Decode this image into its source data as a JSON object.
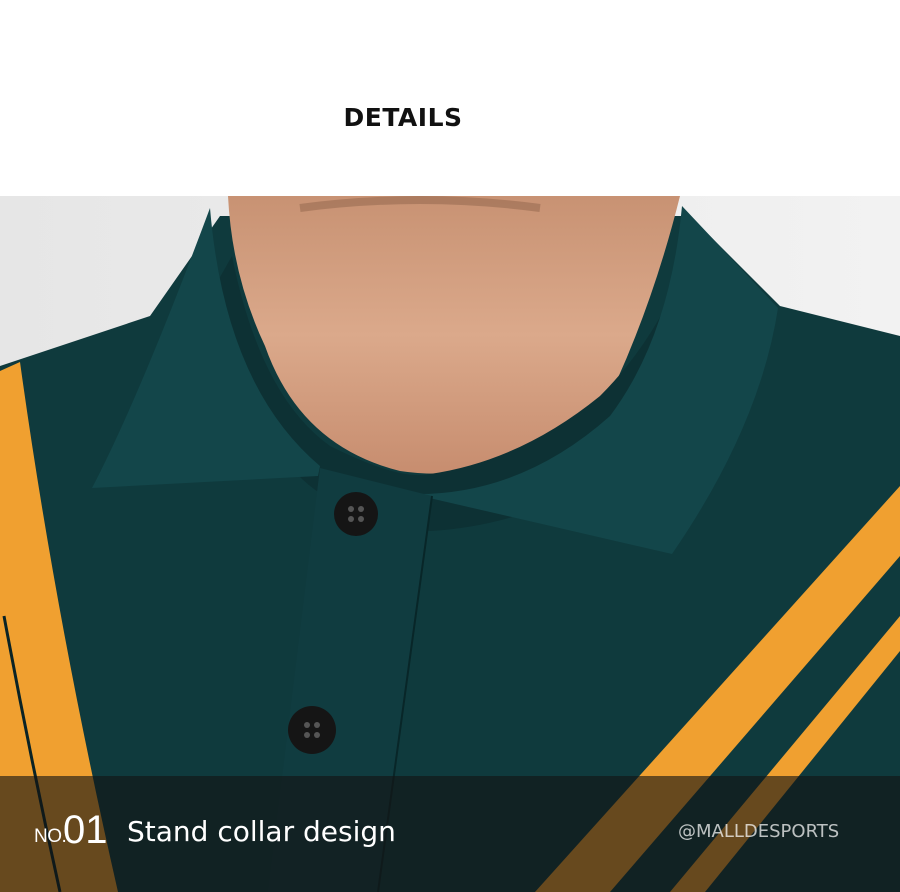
{
  "header": {
    "title": "DETAILS"
  },
  "photo": {
    "subject": "polo-collar-closeup",
    "colors": {
      "shirt": "#0f3a3d",
      "stripe": "#f0a030",
      "skin": "#d8a484",
      "background": "#ebebeb"
    }
  },
  "caption": {
    "number_prefix": "NO.",
    "number": "01",
    "text": "Stand collar design",
    "watermark": "@MALLDESPORTS"
  }
}
